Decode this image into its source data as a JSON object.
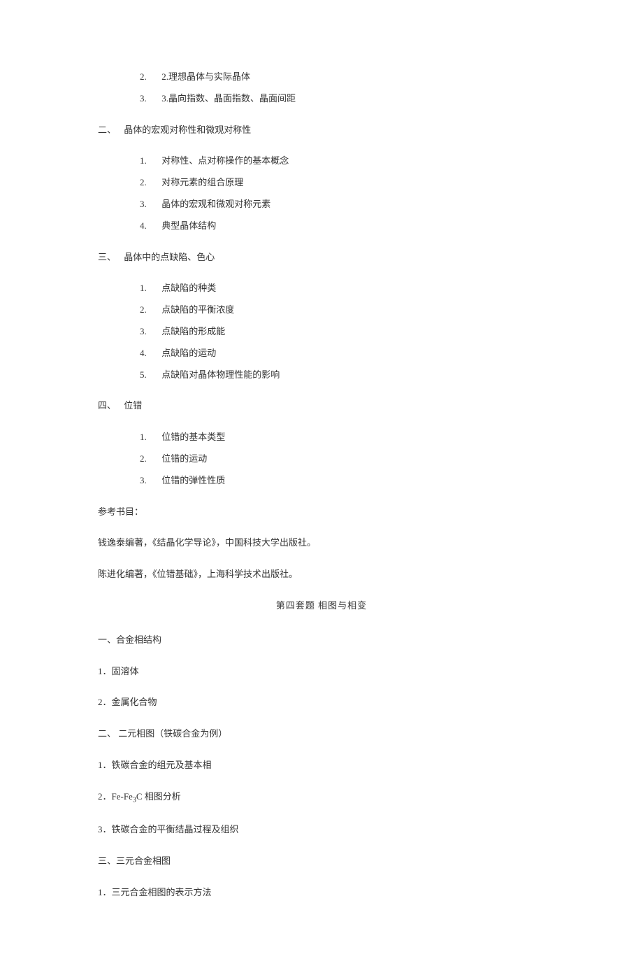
{
  "topList": {
    "items": [
      {
        "num": "2.",
        "text": "2.理想晶体与实际晶体"
      },
      {
        "num": "3.",
        "text": "3.晶向指数、晶面指数、晶面间距"
      }
    ]
  },
  "section2": {
    "label": "二、",
    "title": "晶体的宏观对称性和微观对称性",
    "items": [
      {
        "num": "1.",
        "text": "对称性、点对称操作的基本概念"
      },
      {
        "num": "2.",
        "text": "对称元素的组合原理"
      },
      {
        "num": "3.",
        "text": "晶体的宏观和微观对称元素"
      },
      {
        "num": "4.",
        "text": "典型晶体结构"
      }
    ]
  },
  "section3": {
    "label": "三、",
    "title": "晶体中的点缺陷、色心",
    "items": [
      {
        "num": "1.",
        "text": "点缺陷的种类"
      },
      {
        "num": "2.",
        "text": "点缺陷的平衡浓度"
      },
      {
        "num": "3.",
        "text": "点缺陷的形成能"
      },
      {
        "num": "4.",
        "text": "点缺陷的运动"
      },
      {
        "num": "5.",
        "text": "点缺陷对晶体物理性能的影响"
      }
    ]
  },
  "section4": {
    "label": "四、",
    "title": "位错",
    "items": [
      {
        "num": "1.",
        "text": "位错的基本类型"
      },
      {
        "num": "2.",
        "text": "位错的运动"
      },
      {
        "num": "3.",
        "text": "位错的弹性性质"
      }
    ]
  },
  "references": {
    "label": "参考书目：",
    "ref1": "钱逸泰编著，《结晶化学导论》，中国科技大学出版社。",
    "ref2": "陈进化编著，《位错基础》，上海科学技术出版社。"
  },
  "set4": {
    "title": "第四套题  相图与相变",
    "s1": {
      "heading": "一、合金相结构",
      "i1": "1．固溶体",
      "i2": "2．金属化合物"
    },
    "s2": {
      "heading": "二、  二元相图（铁碳合金为例）",
      "i1": "1．铁碳合金的组元及基本相",
      "i2_pre": "2．Fe-Fe",
      "i2_sub": "3",
      "i2_post": "C 相图分析",
      "i3": "3．铁碳合金的平衡结晶过程及组织"
    },
    "s3": {
      "heading": "三、三元合金相图",
      "i1": "1．三元合金相图的表示方法"
    }
  }
}
